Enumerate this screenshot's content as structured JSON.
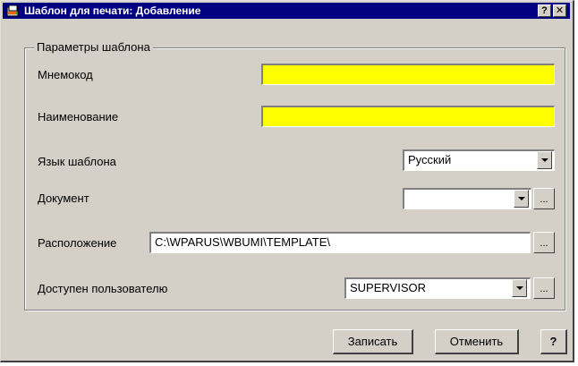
{
  "window": {
    "title": "Шаблон для печати: Добавление",
    "help_button": "?",
    "close_button": "✕"
  },
  "group": {
    "title": "Параметры шаблона"
  },
  "fields": {
    "mnemocode": {
      "label": "Мнемокод",
      "value": ""
    },
    "name": {
      "label": "Наименование",
      "value": ""
    },
    "language": {
      "label": "Язык шаблона",
      "value": "Русский"
    },
    "document": {
      "label": "Документ",
      "value": ""
    },
    "location": {
      "label": "Расположение",
      "value": "C:\\WPARUS\\WBUMI\\TEMPLATE\\"
    },
    "user": {
      "label": "Доступен пользователю",
      "value": "SUPERVISOR"
    }
  },
  "ellipsis_label": "...",
  "buttons": {
    "save": "Записать",
    "cancel": "Отменить",
    "help": "?"
  },
  "colors": {
    "titlebar": "#000080",
    "required_field": "#ffff00",
    "face": "#d4d0c8"
  },
  "icons": {
    "title": "template-app-icon",
    "dropdown": "chevron-down-icon"
  }
}
